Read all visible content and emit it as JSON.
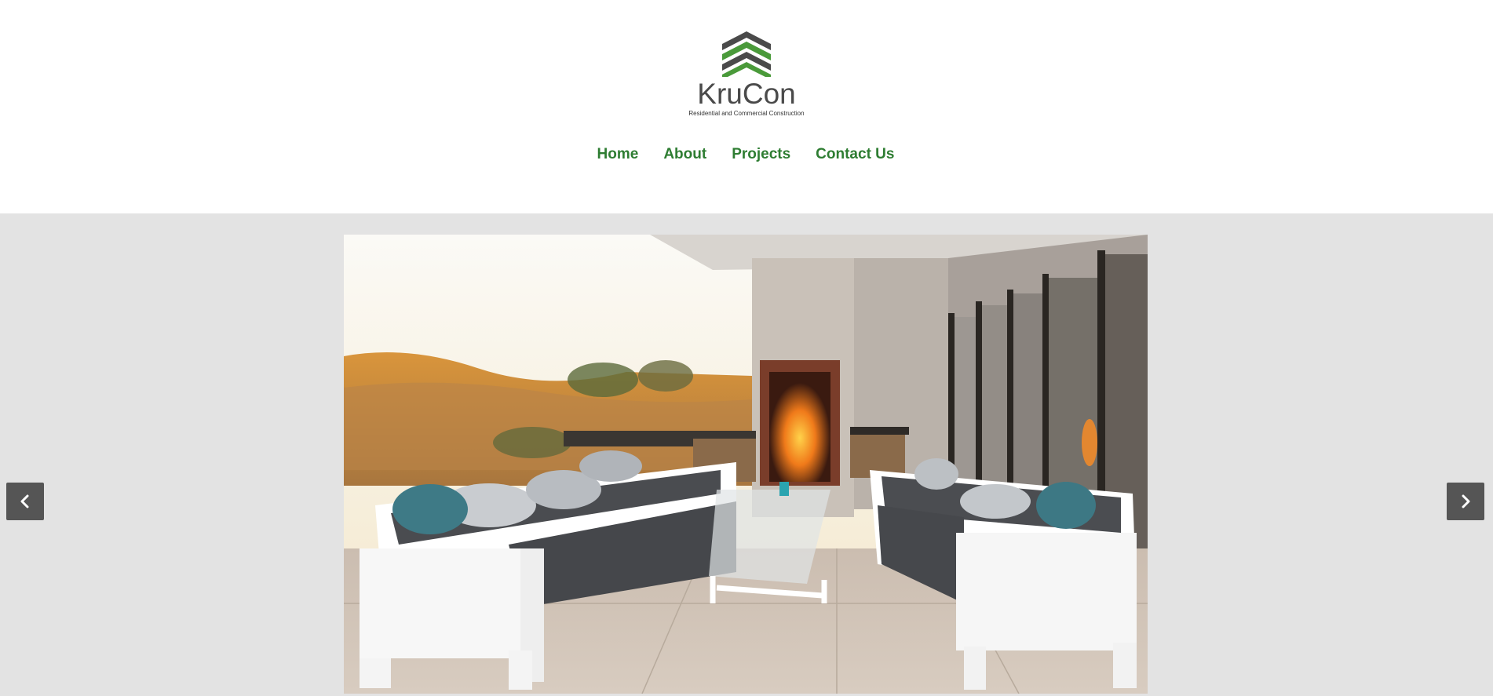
{
  "brand": {
    "name": "KruCon",
    "tagline": "Residential and Commercial Construction",
    "colors": {
      "green": "#4a9a3a",
      "dark": "#4a4a4a"
    }
  },
  "nav": {
    "items": [
      {
        "label": "Home"
      },
      {
        "label": "About"
      },
      {
        "label": "Projects"
      },
      {
        "label": "Contact Us"
      }
    ],
    "color": "#2e7d32"
  },
  "carousel": {
    "prev_icon": "chevron-left-icon",
    "next_icon": "chevron-right-icon",
    "background": "#e3e3e3"
  }
}
